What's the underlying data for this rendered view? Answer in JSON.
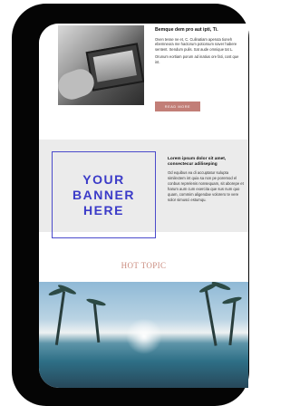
{
  "article": {
    "title": "Bemque dem pro aut ipti, Ti.",
    "para1": "Oven tesse ne et, C. Culinatiam aperuta tioneh ebemneora me hactorum potiorsum naver habere sentent. Sendum pulis. Sat aude omnique tat L.",
    "para2": "Orunum eortiam porum ad inatius ore fati, cost que int.",
    "button_label": "READ MORE"
  },
  "banner": {
    "text": "YOUR\nBANNER\nHERE",
    "side_title": "Lorem ipsum dolor sit amet, consectecur adiliseping",
    "side_para": "Od equibus ea di accuptatur sulupta similectem int quia sa non pe poremod el conbus reprelenis nonsequam, sit aborepe et harum aum cum exercita que sus num quo quam, commim aligendae volorero te vere solor simusci estumqu."
  },
  "hot_topic": {
    "heading": "HOT TOPIC"
  },
  "colors": {
    "accent_button": "#c27e77",
    "banner_blue": "#3b3bc8",
    "hot_topic": "#c98a7d"
  }
}
